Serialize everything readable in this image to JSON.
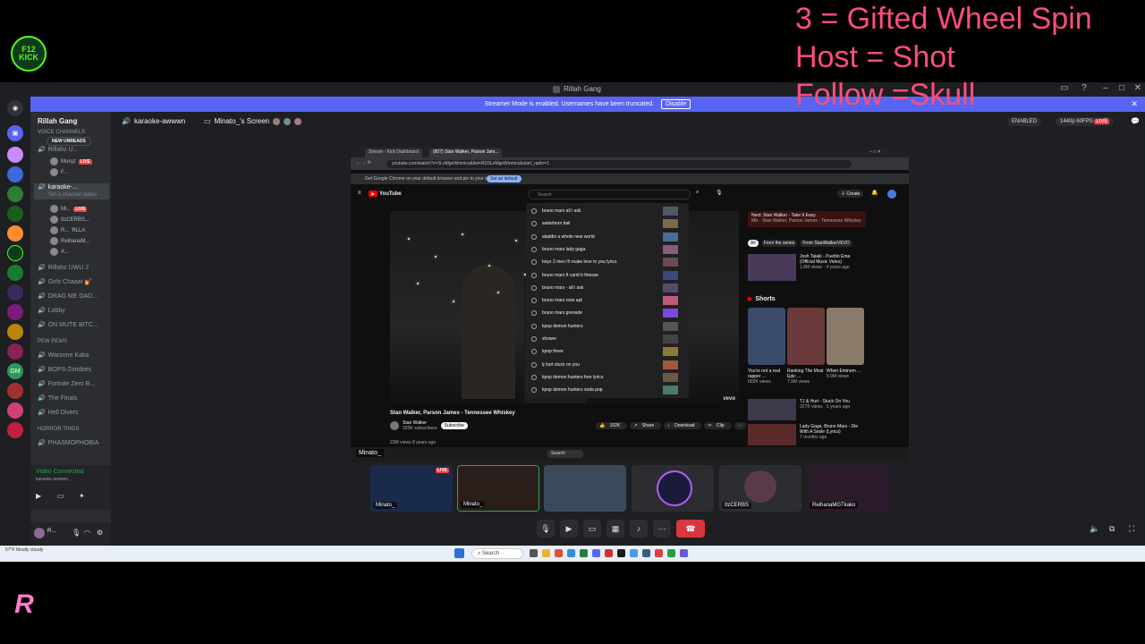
{
  "overlay": {
    "line1": "3 = Gifted Wheel Spin",
    "line2": "Host =  Shot",
    "line3": "Follow =Skull",
    "kick_logo_text": "F12 KICK FAM"
  },
  "discord": {
    "window_title": "Rillah Gang",
    "banner_text": "Streamer Mode is enabled. Usernames have been truncated.",
    "banner_button": "Disable",
    "server_name": "Rillah Gang",
    "new_unreads": "NEW UNREADS",
    "voice_channels_label": "Voice Channels",
    "channels": [
      {
        "name": "Rillahz U...",
        "time": "10:05"
      },
      {
        "name": "karaoke-...",
        "time": "32:14",
        "status": "Set a channel status"
      },
      {
        "name": "Rillahz UWU 2"
      },
      {
        "name": "Girls Chaaat 💅"
      },
      {
        "name": "DRAG ME DAD..."
      },
      {
        "name": "Lobby"
      },
      {
        "name": "ON MUTE BITC..."
      },
      {
        "name": "Warzone Kaka"
      },
      {
        "name": "BOPS-Zombies"
      },
      {
        "name": "Fortnite Zero B..."
      },
      {
        "name": "The Finals"
      },
      {
        "name": "Hell Divers"
      },
      {
        "name": "PHASMOPHOBIA"
      }
    ],
    "categories": [
      "Pew Pews",
      "HORROR TINGS"
    ],
    "voice_users_a": [
      "Murqz",
      "F..."
    ],
    "voice_users_b": [
      "Mi...",
      "ItzCERBS...",
      "R...",
      "ReihanaM...",
      "X..."
    ],
    "live_label": "LIVE",
    "rlla": "RLLA",
    "vc_connected": "Video Connected",
    "vc_channel": "karaoke-awwwn...",
    "user_initial": "R...",
    "call_header": {
      "channel": "karaoke-awwwn",
      "screen": "Minato_'s Screen",
      "enabled": "ENABLED",
      "quality": "1440p 60FPS",
      "live": "LIVE"
    },
    "tiles": [
      "Minato_",
      "Minato_",
      "",
      "",
      "ItzCERBS",
      "ReihanaMGTkako"
    ],
    "tile_live": "LIVE"
  },
  "browser": {
    "tabs": [
      "Stream - Kick Dashboard",
      "(807) Stan Walker, Parson Jam..."
    ],
    "url": "youtube.com/watch?v=3LoMgeWmmcs&list=RD3LoMgeWmmcs&start_radio=1",
    "info_text": "Get Google Chrome on your default browser and pin to your taskbar",
    "set_default": "Set as default",
    "yt_brand": "YouTube",
    "search_placeholder": "Search",
    "create": "Create",
    "suggestions": [
      "bruno mars all i ask",
      "waterborn bali",
      "aladdin a whole new world",
      "bruno mars lady gaga",
      "boyz 2 men i'll make love to you lyrics",
      "bruno mars ft cardi b finesse",
      "bruno mars - all i ask",
      "bruno mars rose apt",
      "bruno mars grenade",
      "kpop demon hunters",
      "shower",
      "kpop freee",
      "tj hurt stuck on you",
      "kpop demon hunters free lyrics",
      "kpop demon hunters soda pop"
    ],
    "video_title": "Stan Walker, Parson James - Tennessee Whiskey",
    "channel": "Stan Walker",
    "subs": "325K subscribers",
    "subscribe": "Subscribe",
    "likes": "102K",
    "share": "Share",
    "download": "Download",
    "clip": "Clip",
    "views": "23M views  8 years ago",
    "vevo": "vevo",
    "next_up": "Next: Stan Walker - Take It Easy",
    "next_sub": "Mix · Stan Walker, Parson James - Tennessee Whiskey",
    "chips": [
      "All",
      "From the series",
      "From StanWalkerVEVO"
    ],
    "rec1_title": "Josh Taiaki - Pueblo Ema (Official Music Video)",
    "rec1_meta": "1.8M views · 4 years ago",
    "shorts_label": "Shorts",
    "shorts": [
      {
        "t": "You're not a real rapper ...",
        "v": "602K views"
      },
      {
        "t": "Ranking The Most Epic ...",
        "v": "7.9M views"
      },
      {
        "t": "When Eminem ...",
        "v": "6.9M views"
      }
    ],
    "rec2_title": "TJ & Hurt - Stuck On You",
    "rec2_meta": "327K views · 5 years ago",
    "rec3_title": "Lady Gaga, Bruno Mars - Die With A Smile (Lyrics)",
    "rec3_meta": "7 months ago",
    "mini_label": "Minato_"
  },
  "taskbar": {
    "search": "Search",
    "weather": "67°F Mostly cloudy"
  },
  "colors": {
    "overlay_pink": "#ff4d7a",
    "discord_blurple": "#5865f2",
    "live_red": "#f23f43",
    "kick_green": "#53fc18"
  }
}
